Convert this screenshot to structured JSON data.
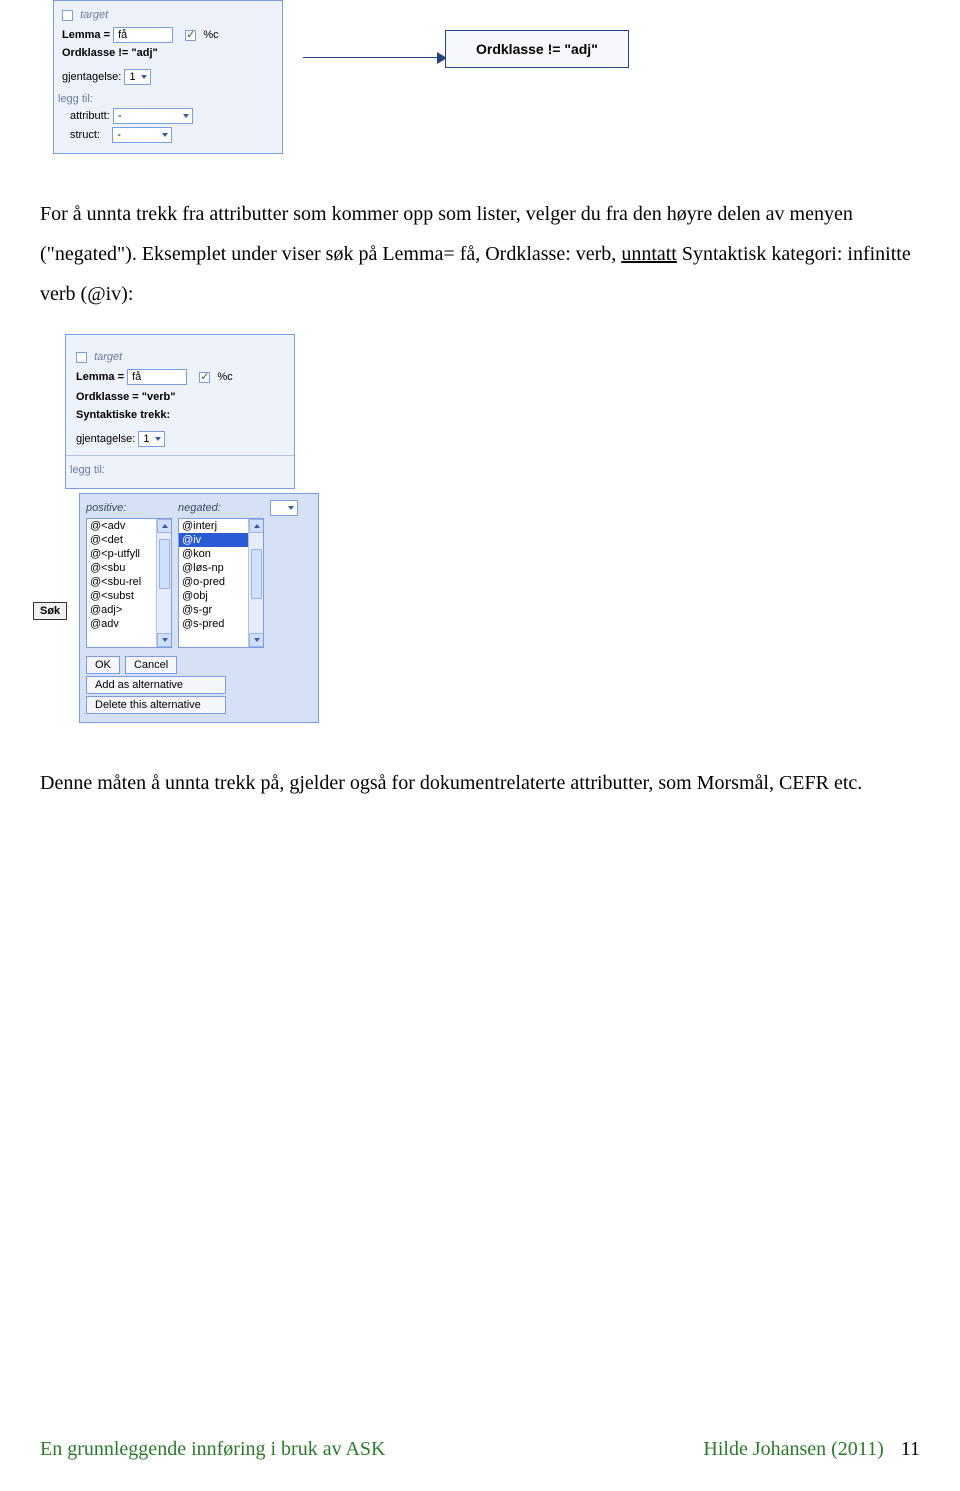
{
  "screenshot1": {
    "target_checkbox": false,
    "target_label": "target",
    "lemma_label": "Lemma =",
    "lemma_value": "få",
    "pc_checkbox": true,
    "pc_label": "%c",
    "ordklasse_line": "Ordklasse != \"adj\"",
    "gjentagelse_label": "gjentagelse:",
    "gjentagelse_value": "1",
    "legg_til_label": "legg til:",
    "attributt_label": "attributt:",
    "attributt_value": "-",
    "struct_label": "struct:",
    "struct_value": "-",
    "callout_text": "Ordklasse != \"adj\""
  },
  "para1": "For å unnta trekk fra attributter som kommer opp som lister, velger du fra den høyre delen av menyen (\"negated\"). Eksemplet under viser søk på Lemma= få, Ordklasse: verb, ",
  "para1_underlined": "unntatt",
  "para1_cont": " Syntaktisk kategori: infinitte verb (@iv):",
  "screenshot2": {
    "target_checkbox": false,
    "target_label": "target",
    "lemma_label": "Lemma =",
    "lemma_value": "få",
    "pc_checkbox": true,
    "pc_label": "%c",
    "ordklasse_line": "Ordklasse = \"verb\"",
    "syntaktiske_label": "Syntaktiske trekk:",
    "gjentagelse_label": "gjentagelse:",
    "gjentagelse_value": "1",
    "legg_til_label": "legg til:",
    "sok_label": "Søk",
    "popup": {
      "positive_header": "positive:",
      "negated_header": "negated:",
      "positive_items": [
        "@<adv",
        "@<det",
        "@<p-utfyll",
        "@<sbu",
        "@<sbu-rel",
        "@<subst",
        "@adj>",
        "@adv"
      ],
      "negated_items": [
        "@interj",
        "@iv",
        "@kon",
        "@løs-np",
        "@o-pred",
        "@obj",
        "@s-gr",
        "@s-pred"
      ],
      "negated_selected_index": 1,
      "ok_label": "OK",
      "cancel_label": "Cancel",
      "add_alt_label": "Add as alternative",
      "del_alt_label": "Delete this alternative"
    }
  },
  "para2": "Denne måten å unnta trekk på, gjelder også for dokumentrelaterte attributter, som Morsmål, CEFR etc.",
  "footer": {
    "left": "En grunnleggende innføring i bruk av ASK",
    "author": "Hilde Johansen (2011)",
    "page": "11"
  }
}
